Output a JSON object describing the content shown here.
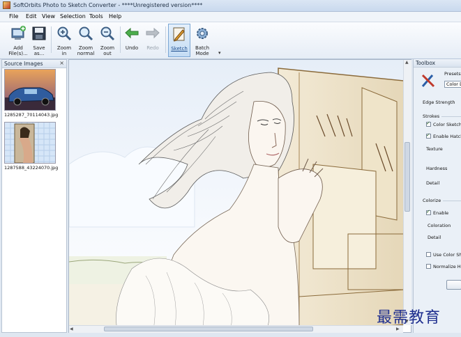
{
  "window": {
    "title": "SoftOrbits Photo to Sketch Converter - ****Unregistered version****"
  },
  "menu": [
    {
      "label": "File"
    },
    {
      "label": "Edit"
    },
    {
      "label": "View"
    },
    {
      "label": "Selection"
    },
    {
      "label": "Tools"
    },
    {
      "label": "Help"
    }
  ],
  "toolbar": {
    "add_files": "Add\nFile(s)...",
    "save_as": "Save\nas...",
    "zoom_in": "Zoom\nin",
    "zoom_normal": "Zoom\nnormal",
    "zoom_out": "Zoom\nout",
    "undo": "Undo",
    "redo": "Redo",
    "sketch": "Sketch",
    "batch_mode": "Batch\nMode",
    "overflow": "▾"
  },
  "source_images": {
    "title": "Source Images",
    "close": "×",
    "items": [
      {
        "caption": "1285287_70114043.jpg",
        "icon": "car-photo-thumbnail"
      },
      {
        "caption": "1287588_43224070.jpg",
        "icon": "woman-photo-thumbnail"
      }
    ]
  },
  "toolbox": {
    "title": "Toolbox",
    "presets_label": "Presets",
    "preset_value": "Color Dr",
    "edge_strength": "Edge Strength",
    "strokes_group": "Strokes",
    "color_sketch": "Color Sketch",
    "color_sketch_checked": true,
    "enable_hatch": "Enable Hatch",
    "enable_hatch_checked": true,
    "texture": "Texture",
    "hardness": "Hardness",
    "detail": "Detail",
    "colorize_group": "Colorize",
    "enable": "Enable",
    "enable_checked": true,
    "coloration": "Coloration",
    "colorize_detail": "Detail",
    "use_color_shift": "Use Color Shi",
    "use_color_shift_checked": false,
    "normalize": "Normalize Hist",
    "normalize_checked": false
  },
  "watermark": "最需教育",
  "colors": {
    "accent": "#7aa6d4",
    "watermark": "#1f2f8f"
  }
}
